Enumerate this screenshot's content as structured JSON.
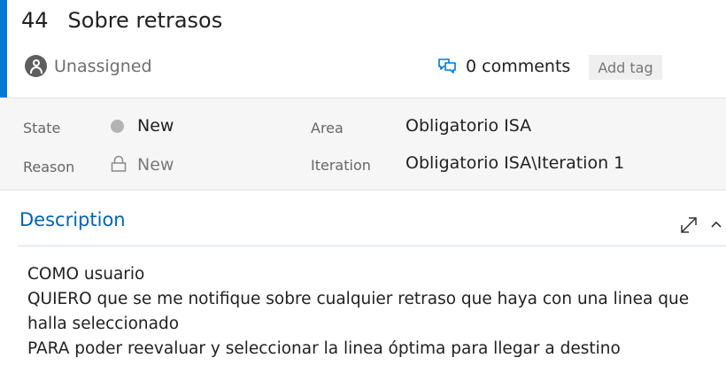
{
  "work_item": {
    "id": "44",
    "title": "Sobre retrasos",
    "assignee": "Unassigned",
    "comments_label": "0 comments",
    "add_tag_label": "Add tag"
  },
  "fields": {
    "state_label": "State",
    "state_value": "New",
    "reason_label": "Reason",
    "reason_value": "New",
    "area_label": "Area",
    "area_value": "Obligatorio ISA",
    "iteration_label": "Iteration",
    "iteration_value": "Obligatorio ISA\\Iteration 1"
  },
  "description": {
    "title": "Description",
    "lines": [
      "COMO usuario",
      "QUIERO que se me notifique sobre cualquier retraso que haya con una linea que",
      "halla seleccionado",
      "PARA poder reevaluar y seleccionar la linea óptima para llegar a destino"
    ]
  },
  "colors": {
    "accent": "#0078d4",
    "link_blue": "#0063b1",
    "state_new": "#b3b3b3"
  },
  "icons": {
    "avatar": "person-avatar-icon",
    "comments": "comments-icon",
    "state": "state-dot-icon",
    "reason": "lock-icon",
    "expand": "expand-icon",
    "collapse": "chevron-up-icon"
  }
}
